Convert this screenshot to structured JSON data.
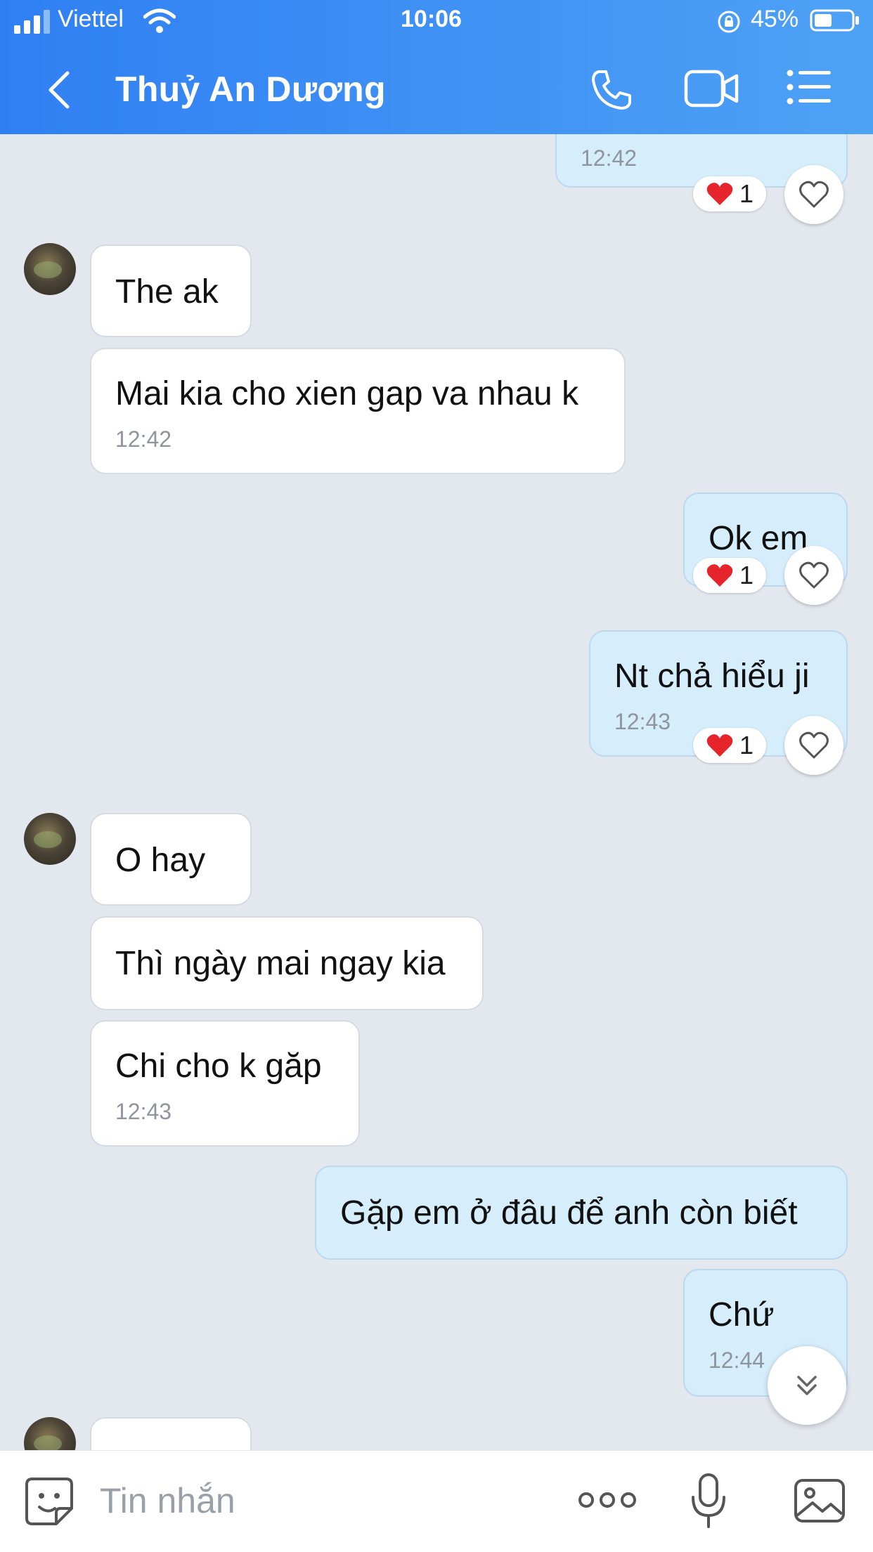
{
  "status_bar": {
    "carrier": "Viettel",
    "time": "10:06",
    "battery": "45%"
  },
  "header": {
    "contact_name": "Thuỷ An Dương"
  },
  "messages": [
    {
      "text": "",
      "time": "12:42",
      "reaction": "1"
    },
    {
      "text": "The ak"
    },
    {
      "text": "Mai kia cho xien gap va nhau k",
      "time": "12:42"
    },
    {
      "text": "Ok em",
      "reaction": "1"
    },
    {
      "text": "Nt chả hiểu ji",
      "time": "12:43",
      "reaction": "1"
    },
    {
      "text": "O hay"
    },
    {
      "text": "Thì ngày mai ngay kia"
    },
    {
      "text": "Chi cho k găp",
      "time": "12:43"
    },
    {
      "text": "Gặp em ở đâu để anh còn biết"
    },
    {
      "text": "Chứ",
      "time": "12:44"
    },
    {
      "text": ""
    }
  ],
  "composer": {
    "placeholder": "Tin nhắn"
  },
  "icons": {
    "back": "chevron-left-icon",
    "phone": "phone-icon",
    "video": "video-camera-icon",
    "menu": "list-menu-icon",
    "heart": "heart-icon",
    "scroll": "double-chevron-down-icon",
    "sticker": "sticker-face-icon",
    "more": "more-dots-icon",
    "mic": "microphone-icon",
    "gallery": "image-gallery-icon"
  },
  "colors": {
    "header_start": "#2f7ff3",
    "header_end": "#4ea2f5",
    "background": "#e3e7ee",
    "outgoing_bubble": "#d6edfc",
    "incoming_bubble": "#ffffff",
    "reaction_heart": "#e5242b"
  }
}
